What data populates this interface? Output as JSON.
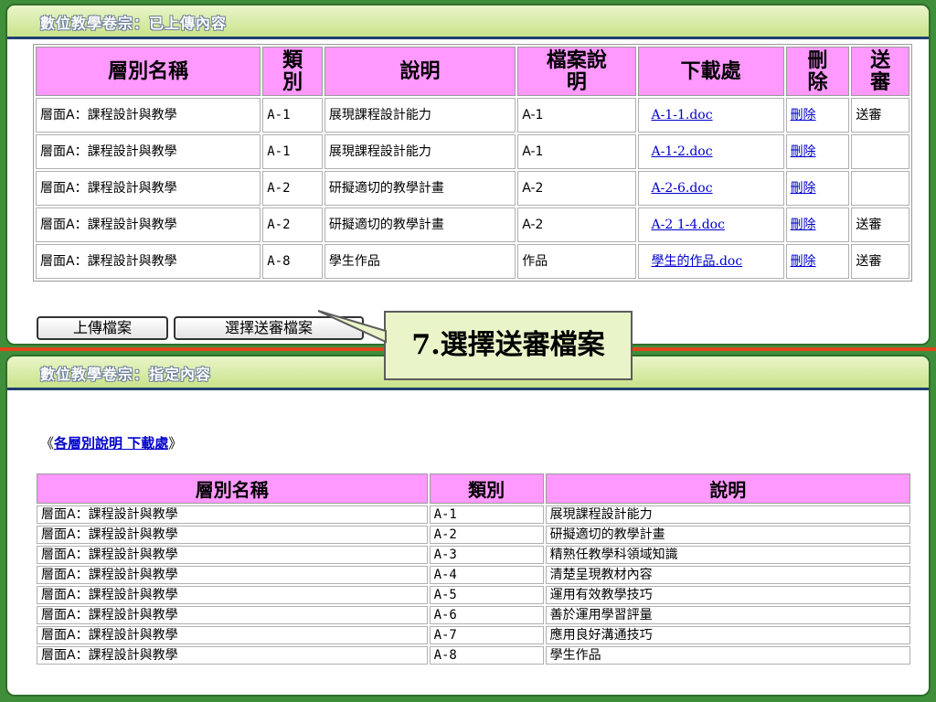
{
  "top_panel": {
    "title": "數位教學卷宗：已上傳內容",
    "headers": [
      "層別名稱",
      "類別",
      "說明",
      "檔案說明",
      "下載處",
      "刪除",
      "送審"
    ],
    "rows": [
      {
        "layer": "層面A：課程設計與教學",
        "category": "A-1",
        "description": "展現課程設計能力",
        "file_desc": "A-1",
        "download": "A-1-1.doc",
        "delete": "刪除",
        "review": "送審"
      },
      {
        "layer": "層面A：課程設計與教學",
        "category": "A-1",
        "description": "展現課程設計能力",
        "file_desc": "A-1",
        "download": "A-1-2.doc",
        "delete": "刪除",
        "review": ""
      },
      {
        "layer": "層面A：課程設計與教學",
        "category": "A-2",
        "description": "研擬適切的教學計畫",
        "file_desc": "A-2",
        "download": "A-2-6.doc",
        "delete": "刪除",
        "review": ""
      },
      {
        "layer": "層面A：課程設計與教學",
        "category": "A-2",
        "description": "研擬適切的教學計畫",
        "file_desc": "A-2",
        "download": "A-2 1-4.doc",
        "delete": "刪除",
        "review": "送審"
      },
      {
        "layer": "層面A：課程設計與教學",
        "category": "A-8",
        "description": "學生作品",
        "file_desc": "作品",
        "download": "學生的作品.doc",
        "delete": "刪除",
        "review": "送審"
      }
    ],
    "upload_button": "上傳檔案",
    "select_review_button": "選擇送審檔案"
  },
  "callout": {
    "text": "7.選擇送審檔案"
  },
  "bottom_panel": {
    "title": "數位教學卷宗：指定內容",
    "spec_link_open": "《",
    "spec_link": "各層別說明 下載處",
    "spec_link_close": "》",
    "headers": [
      "層別名稱",
      "類別",
      "說明"
    ],
    "rows": [
      {
        "layer": "層面A：課程設計與教學",
        "category": "A-1",
        "description": "展現課程設計能力"
      },
      {
        "layer": "層面A：課程設計與教學",
        "category": "A-2",
        "description": "研擬適切的教學計畫"
      },
      {
        "layer": "層面A：課程設計與教學",
        "category": "A-3",
        "description": "精熟任教學科領域知識"
      },
      {
        "layer": "層面A：課程設計與教學",
        "category": "A-4",
        "description": "清楚呈現教材內容"
      },
      {
        "layer": "層面A：課程設計與教學",
        "category": "A-5",
        "description": "運用有效教學技巧"
      },
      {
        "layer": "層面A：課程設計與教學",
        "category": "A-6",
        "description": "善於運用學習評量"
      },
      {
        "layer": "層面A：課程設計與教學",
        "category": "A-7",
        "description": "應用良好溝通技巧"
      },
      {
        "layer": "層面A：課程設計與教學",
        "category": "A-8",
        "description": "學生作品"
      }
    ]
  },
  "colors": {
    "background": "#3f8f3a",
    "header_pink": "#ff99ff",
    "divider": "#e0441a",
    "link": "#0000cc",
    "callout_bg": "#e9f5c9"
  }
}
